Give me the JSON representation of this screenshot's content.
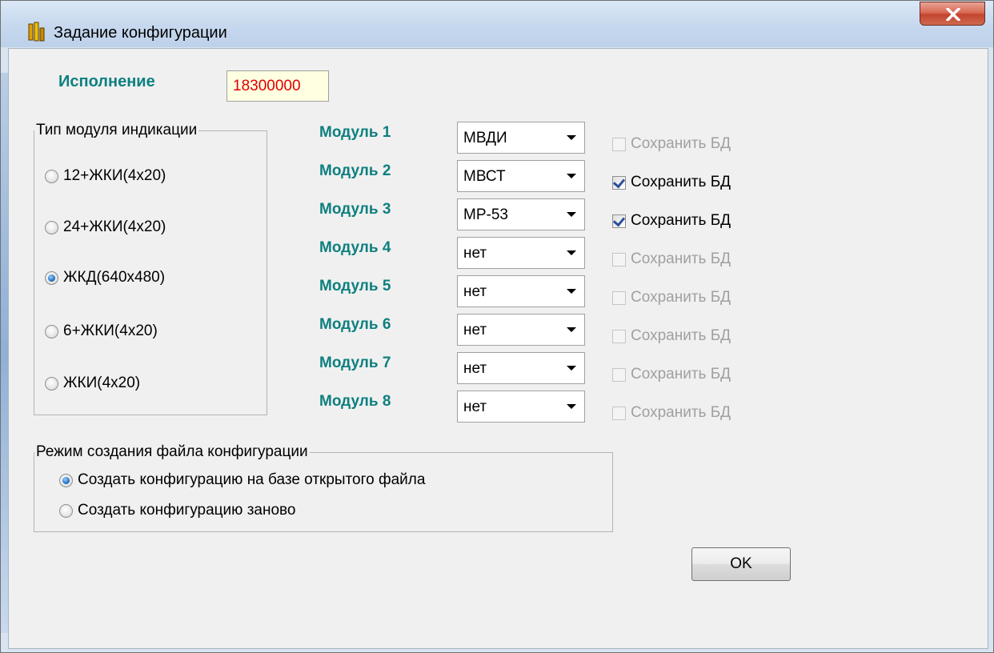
{
  "window": {
    "title": "Задание конфигурации"
  },
  "execution": {
    "label": "Исполнение",
    "value": "18300000"
  },
  "indication_group": {
    "title": "Тип модуля индикации",
    "options": [
      {
        "label": "12+ЖКИ(4x20)",
        "checked": false
      },
      {
        "label": "24+ЖКИ(4x20)",
        "checked": false
      },
      {
        "label": "ЖКД(640x480)",
        "checked": true
      },
      {
        "label": "6+ЖКИ(4x20)",
        "checked": false
      },
      {
        "label": "ЖКИ(4x20)",
        "checked": false
      }
    ]
  },
  "modules": [
    {
      "label": "Модуль 1",
      "value": "МВДИ",
      "save_label": "Сохранить БД",
      "save_checked": false,
      "save_enabled": false
    },
    {
      "label": "Модуль 2",
      "value": "МВСТ",
      "save_label": "Сохранить БД",
      "save_checked": true,
      "save_enabled": true
    },
    {
      "label": "Модуль 3",
      "value": "МР-53",
      "save_label": "Сохранить БД",
      "save_checked": true,
      "save_enabled": true
    },
    {
      "label": "Модуль 4",
      "value": "нет",
      "save_label": "Сохранить БД",
      "save_checked": false,
      "save_enabled": false
    },
    {
      "label": "Модуль 5",
      "value": "нет",
      "save_label": "Сохранить БД",
      "save_checked": false,
      "save_enabled": false
    },
    {
      "label": "Модуль 6",
      "value": "нет",
      "save_label": "Сохранить БД",
      "save_checked": false,
      "save_enabled": false
    },
    {
      "label": "Модуль 7",
      "value": "нет",
      "save_label": "Сохранить БД",
      "save_checked": false,
      "save_enabled": false
    },
    {
      "label": "Модуль 8",
      "value": "нет",
      "save_label": "Сохранить БД",
      "save_checked": false,
      "save_enabled": false
    }
  ],
  "mode_group": {
    "title": "Режим создания файла конфигурации",
    "options": [
      {
        "label": "Создать конфигурацию на базе открытого файла",
        "checked": true
      },
      {
        "label": "Создать конфигурацию заново",
        "checked": false
      }
    ]
  },
  "buttons": {
    "ok": "OK"
  },
  "colors": {
    "label_teal": "#0e7f7f",
    "exec_value": "#e00000",
    "exec_bg": "#ffffe1"
  }
}
